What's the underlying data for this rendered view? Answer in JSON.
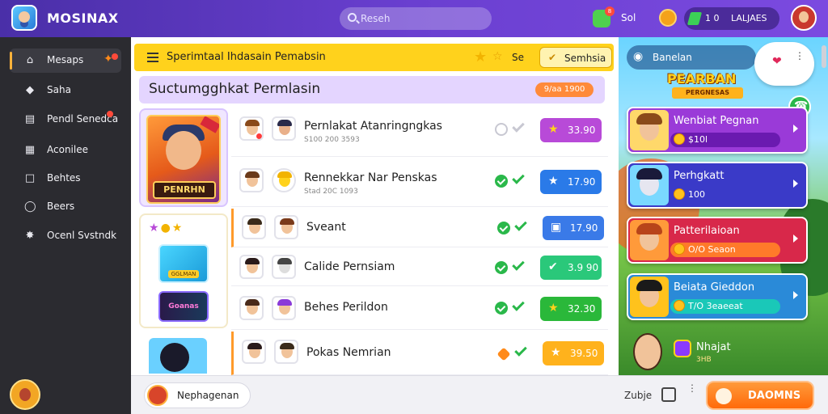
{
  "app": {
    "title": "MOSINAX"
  },
  "search": {
    "placeholder": "Reseh"
  },
  "topbar": {
    "notif_badge": "8",
    "notif_label": "Sol",
    "stat_primary": "1 0",
    "stat_secondary": "LALJAES"
  },
  "sidebar": {
    "items": [
      {
        "label": "Mesaps",
        "icon": "home-icon"
      },
      {
        "label": "Saha",
        "icon": "diamond-icon"
      },
      {
        "label": "Pendl Senedca",
        "icon": "calendar-icon"
      },
      {
        "label": "Aconilee",
        "icon": "building-icon"
      },
      {
        "label": "Behtes",
        "icon": "tag-icon"
      },
      {
        "label": "Beers",
        "icon": "clock-icon"
      },
      {
        "label": "Ocenl Svstndk",
        "icon": "puzzle-icon"
      }
    ]
  },
  "toolbar": {
    "title": "Sperimtaal Ihdasain Pemabsin",
    "count": "Se",
    "button_label": "Semhsia"
  },
  "section": {
    "title": "Suctumgghkat Permlasin",
    "pill": "9/aa 1900"
  },
  "feature": {
    "label": "PENRHN"
  },
  "promo": {
    "thumb_a_label": "GGLMAN",
    "thumb_b_label": "Goanas"
  },
  "quests": [
    {
      "title": "Pernlakat Atanringngkas",
      "sub": "S100 200 3593",
      "status": "gray",
      "reward": "33.90",
      "reward_color": "#b84ad8",
      "reward_icon": "star-icon"
    },
    {
      "title": "Rennekkar Nar Penskas",
      "sub": "Stad 20C 1093",
      "status": "green",
      "reward": "17.90",
      "reward_color": "#2a7ae8",
      "reward_icon": "star-icon"
    },
    {
      "title": "Sveant",
      "sub": "",
      "status": "green",
      "reward": "17.90",
      "reward_color": "#3a7ae8",
      "reward_icon": "box-icon"
    },
    {
      "title": "Calide Pernsiam",
      "sub": "",
      "status": "green",
      "reward": "3.9 90",
      "reward_color": "#2ac87a",
      "reward_icon": "check-circle-icon"
    },
    {
      "title": "Behes Perildon",
      "sub": "",
      "status": "green",
      "reward": "32.30",
      "reward_color": "#2ab83a",
      "reward_icon": "star-icon"
    },
    {
      "title": "Pokas Nemrian",
      "sub": "",
      "status": "orange",
      "reward": "39.50",
      "reward_color": "#ffb21c",
      "reward_icon": "star-icon"
    }
  ],
  "right": {
    "head_label": "Banelan",
    "logo_title": "PEARBAN",
    "logo_sub": "PERGNESAS",
    "cards": [
      {
        "title": "Wenbiat Pegnan",
        "value": "$10l",
        "bg": "#9a3ad8",
        "bar": "#6a1ab0"
      },
      {
        "title": "Perhgkatt",
        "value": "100",
        "bg": "#3a3ac8",
        "bar": "#2a2aa0"
      },
      {
        "title": "Patterilaioan",
        "value": "O/O Seaon",
        "bg": "#d8284a",
        "bar": "#ff7a2a"
      },
      {
        "title": "Beiata Gieddon",
        "value": "T/O 3eaeeat",
        "bg": "#2a8ad8",
        "bar": "#1ac8b8"
      }
    ],
    "last_title": "Nhajat",
    "last_sub": "3HB"
  },
  "bottom": {
    "user_label": "Nephagenan",
    "label": "Zubje",
    "button_label": "DAOMNS"
  }
}
